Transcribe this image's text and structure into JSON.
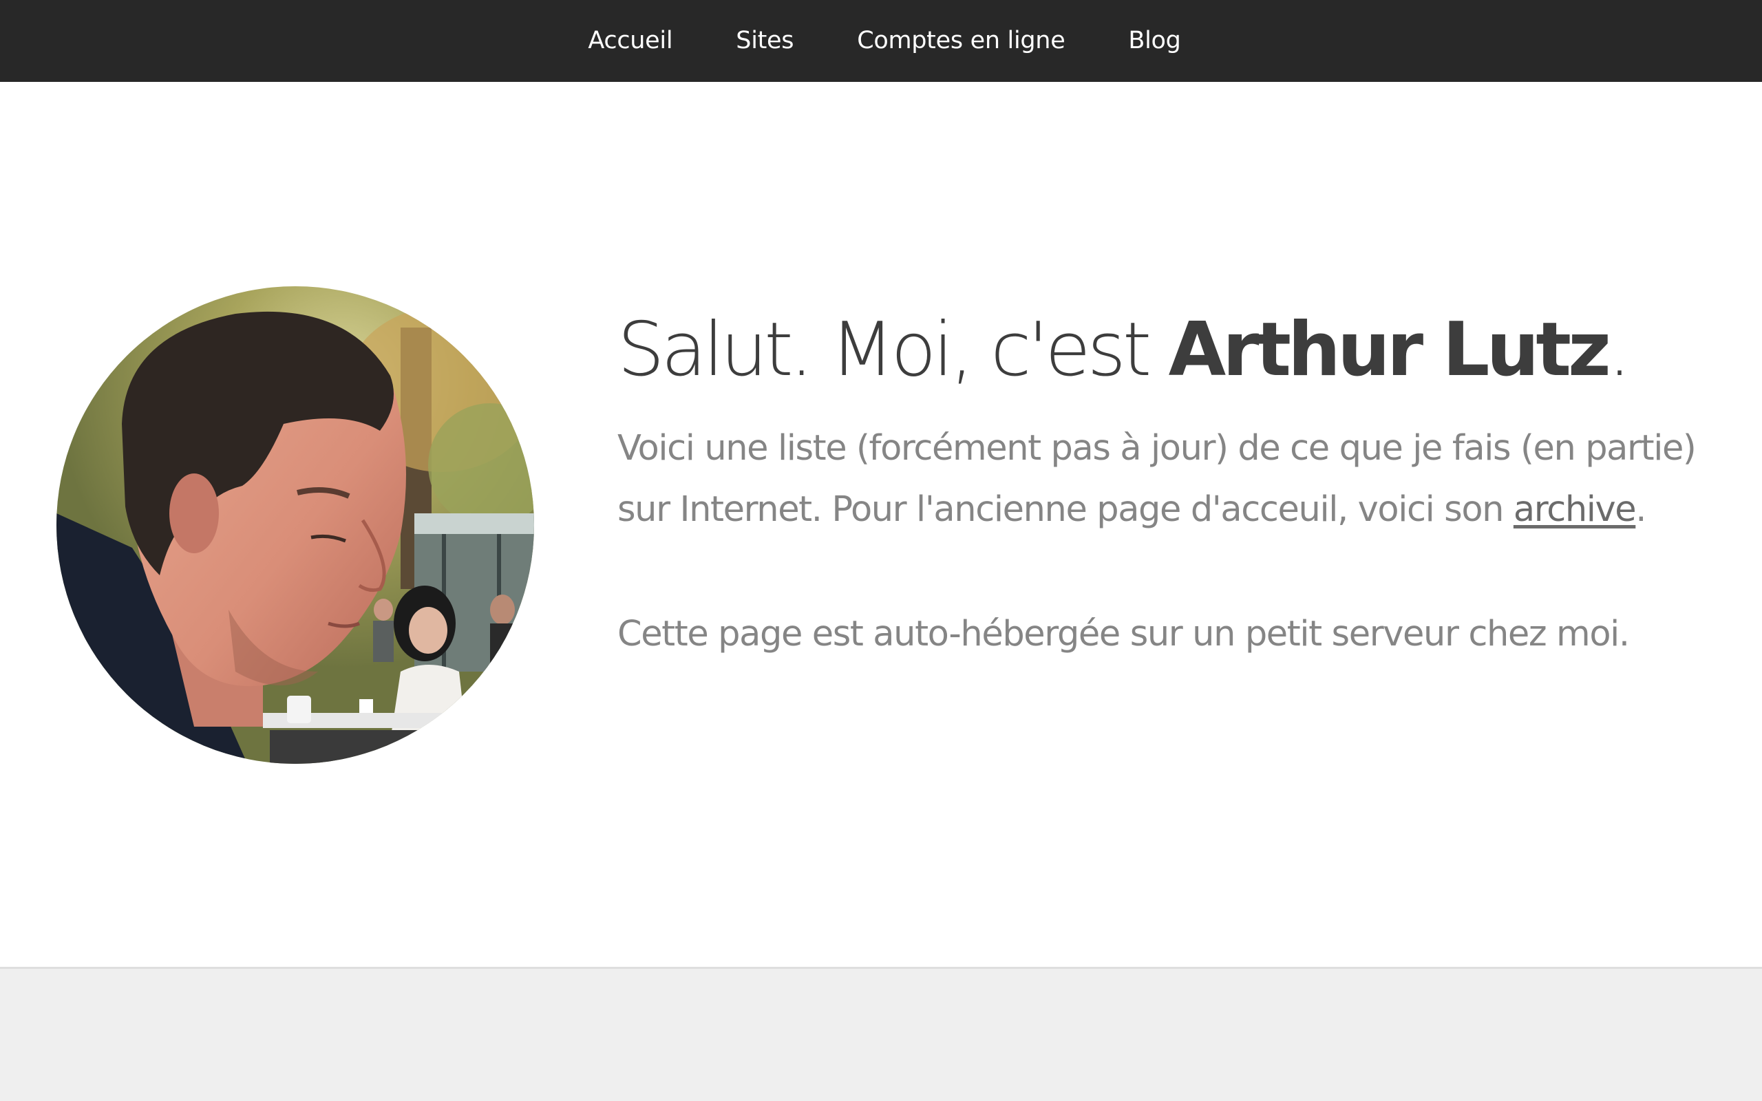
{
  "nav": {
    "items": [
      {
        "label": "Accueil"
      },
      {
        "label": "Sites"
      },
      {
        "label": "Comptes en ligne"
      },
      {
        "label": "Blog"
      }
    ]
  },
  "hero": {
    "headline_prefix": "Salut. Moi, c'est ",
    "headline_name": "Arthur Lutz",
    "headline_suffix": ".",
    "intro_text": "Voici une liste (forcément pas à jour) de ce que je fais (en partie) sur Internet. Pour l'ancienne page d'acceuil, voici son ",
    "intro_link": "archive",
    "intro_suffix": ".",
    "note": "Cette page est auto-hébergée sur un petit serveur chez moi."
  },
  "colors": {
    "nav_background": "#282828",
    "nav_text": "#ffffff",
    "headline": "#3d3d3d",
    "body_text": "#858585",
    "footer_background": "#efefef"
  }
}
